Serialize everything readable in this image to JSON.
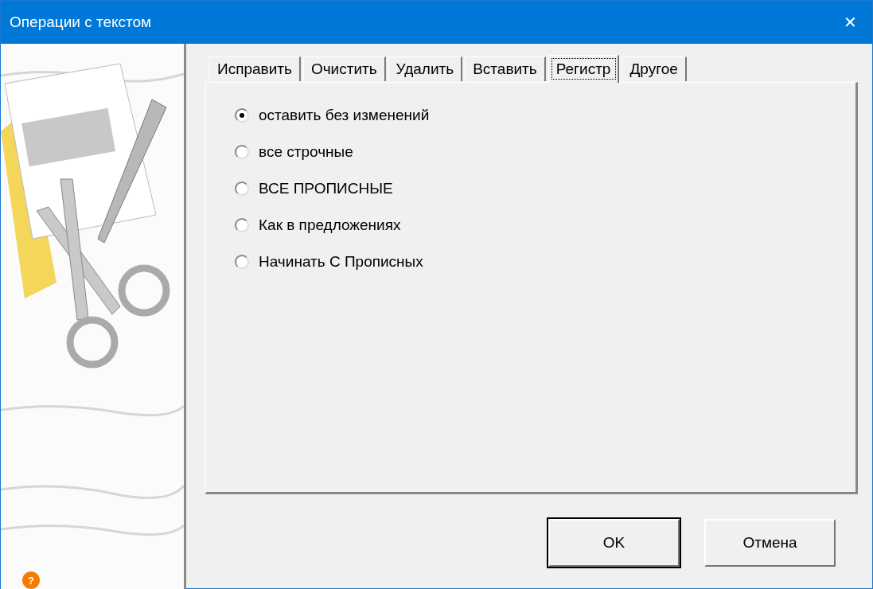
{
  "window": {
    "title": "Операции с текстом",
    "close": "✕"
  },
  "sidebar": {
    "kind": "picture",
    "help": "?"
  },
  "tabs": [
    {
      "label": "Исправить",
      "selected": false
    },
    {
      "label": "Очистить",
      "selected": false
    },
    {
      "label": "Удалить",
      "selected": false
    },
    {
      "label": "Вставить",
      "selected": false
    },
    {
      "label": "Регистр",
      "selected": true
    },
    {
      "label": "Другое",
      "selected": false
    }
  ],
  "options": [
    {
      "label": "оставить без изменений",
      "selected": true
    },
    {
      "label": "все строчные",
      "selected": false
    },
    {
      "label": "ВСЕ ПРОПИСНЫЕ",
      "selected": false
    },
    {
      "label": "Как в предложениях",
      "selected": false
    },
    {
      "label": "Начинать С Прописных",
      "selected": false
    }
  ],
  "buttons": [
    {
      "label": "OK",
      "default": true
    },
    {
      "label": "Отмена",
      "default": false
    }
  ]
}
